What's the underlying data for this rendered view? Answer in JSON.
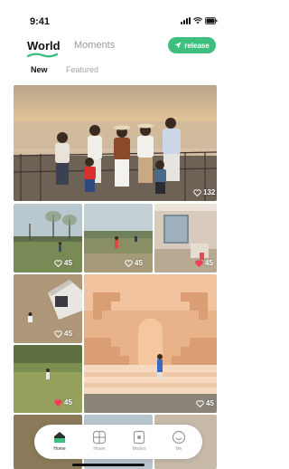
{
  "status": {
    "time": "9:41"
  },
  "header": {
    "tabs": [
      {
        "label": "World",
        "active": true
      },
      {
        "label": "Moments",
        "active": false
      }
    ],
    "release_label": "release",
    "accent": "#3fbf7f"
  },
  "subtabs": [
    {
      "label": "New",
      "active": true
    },
    {
      "label": "Featured",
      "active": false
    }
  ],
  "feed": [
    {
      "id": "family-lake",
      "likes": "132",
      "liked": false
    },
    {
      "id": "lawn-trees",
      "likes": "45",
      "liked": false
    },
    {
      "id": "child-field",
      "likes": "45",
      "liked": false
    },
    {
      "id": "house-patio",
      "likes": "45",
      "liked": true
    },
    {
      "id": "sandbox-house",
      "likes": "45",
      "liked": false
    },
    {
      "id": "stair-sculpture",
      "likes": "45",
      "liked": false
    },
    {
      "id": "garden-kid",
      "likes": "45",
      "liked": true
    }
  ],
  "nav": [
    {
      "label": "Home",
      "icon": "home-icon",
      "active": true
    },
    {
      "label": "Hover",
      "icon": "grid-icon",
      "active": false
    },
    {
      "label": "Modes",
      "icon": "mode-icon",
      "active": false
    },
    {
      "label": "Me",
      "icon": "smile-icon",
      "active": false
    }
  ]
}
